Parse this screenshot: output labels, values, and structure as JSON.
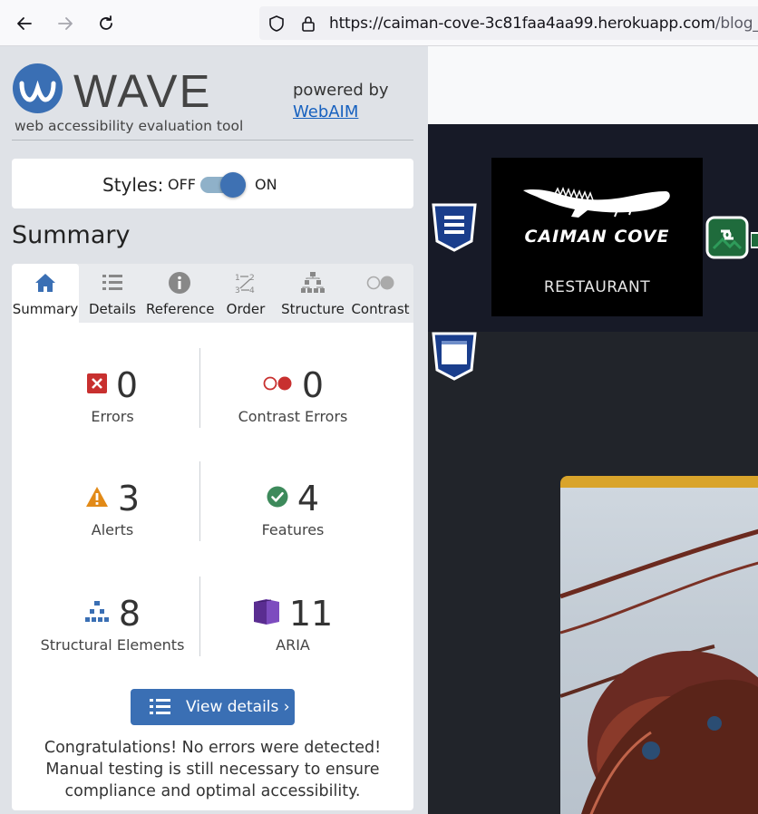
{
  "browser": {
    "url_main": "https://caiman-cove-3c81faa4aa99.herokuapp.com",
    "url_path": "/blog_list/",
    "icons": [
      "back-arrow-icon",
      "forward-arrow-icon",
      "reload-icon",
      "shield-icon",
      "lock-icon"
    ]
  },
  "wave": {
    "title": "WAVE",
    "tagline": "web accessibility evaluation tool",
    "powered_by": "powered by",
    "webaim_link": "WebAIM",
    "styles_label": "Styles:",
    "toggle_off": "OFF",
    "toggle_on": "ON",
    "styles_enabled": true,
    "summary_heading": "Summary",
    "tabs": [
      {
        "label": "Summary",
        "icon": "home-icon",
        "active": true
      },
      {
        "label": "Details",
        "icon": "list-icon",
        "active": false
      },
      {
        "label": "Reference",
        "icon": "info-icon",
        "active": false
      },
      {
        "label": "Order",
        "icon": "order-icon",
        "active": false
      },
      {
        "label": "Structure",
        "icon": "structure-icon",
        "active": false
      },
      {
        "label": "Contrast",
        "icon": "contrast-icon",
        "active": false
      }
    ],
    "stats": {
      "errors": {
        "count": "0",
        "label": "Errors",
        "color": "#c8302f"
      },
      "contrast_errors": {
        "count": "0",
        "label": "Contrast Errors",
        "color": "#c8302f"
      },
      "alerts": {
        "count": "3",
        "label": "Alerts",
        "color": "#e28a17"
      },
      "features": {
        "count": "4",
        "label": "Features",
        "color": "#3d8a5b"
      },
      "structural": {
        "count": "8",
        "label": "Structural Elements",
        "color": "#3a6fb4"
      },
      "aria": {
        "count": "11",
        "label": "ARIA",
        "color": "#5a2d91"
      }
    },
    "view_details_button": "View details ›",
    "congrats_text": "Congratulations! No errors were detected! Manual testing is still necessary to ensure compliance and optimal accessibility."
  },
  "site": {
    "logo_name": "CAIMAN COVE",
    "logo_sub": "RESTAURANT",
    "accent_color": "#d9a42b"
  }
}
